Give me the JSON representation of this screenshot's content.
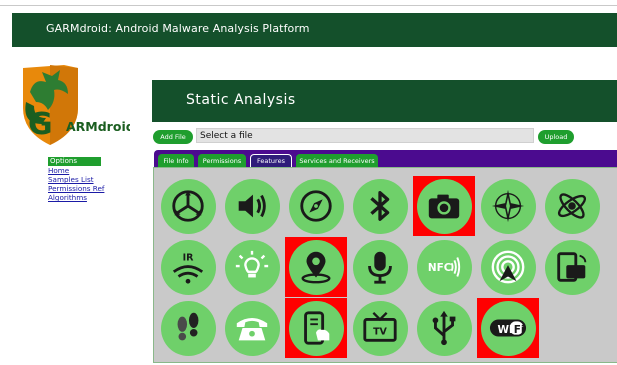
{
  "header": {
    "title": "GARMdroid: Android Malware Analysis Platform"
  },
  "logo": {
    "text": "ARMdroid",
    "letter": "G"
  },
  "sidebar": {
    "options_label": "Options",
    "links": [
      "Home",
      "Samples List",
      "Permissions Ref",
      "Algorithms"
    ]
  },
  "banner": {
    "title": "Static Analysis"
  },
  "upload_form": {
    "add_file_label": "Add File",
    "file_placeholder": "Select a file",
    "upload_label": "Upload"
  },
  "tabs": [
    "File Info",
    "Permissions",
    "Features",
    "Services and Receivers"
  ],
  "active_tab": "Features",
  "features": [
    {
      "icon": "accelerometer-icon",
      "highlighted": false
    },
    {
      "icon": "speaker-icon",
      "highlighted": false
    },
    {
      "icon": "compass-icon",
      "highlighted": false
    },
    {
      "icon": "bluetooth-icon",
      "highlighted": false
    },
    {
      "icon": "camera-icon",
      "highlighted": true
    },
    {
      "icon": "compass-rose-icon",
      "highlighted": false
    },
    {
      "icon": "gyroscope-icon",
      "highlighted": false
    },
    {
      "icon": "infrared-icon",
      "highlighted": false,
      "label": "IR"
    },
    {
      "icon": "light-sensor-icon",
      "highlighted": false
    },
    {
      "icon": "location-icon",
      "highlighted": true
    },
    {
      "icon": "microphone-icon",
      "highlighted": false
    },
    {
      "icon": "nfc-icon",
      "highlighted": false,
      "label": "NFC"
    },
    {
      "icon": "wifi-direct-icon",
      "highlighted": false
    },
    {
      "icon": "screen-rotation-icon",
      "highlighted": false
    },
    {
      "icon": "step-counter-icon",
      "highlighted": false
    },
    {
      "icon": "telephone-icon",
      "highlighted": false
    },
    {
      "icon": "touchscreen-icon",
      "highlighted": true
    },
    {
      "icon": "tv-icon",
      "highlighted": false,
      "label": "TV"
    },
    {
      "icon": "usb-icon",
      "highlighted": false
    },
    {
      "icon": "wifi-icon",
      "highlighted": true,
      "label": "Wi Fi"
    }
  ],
  "colors": {
    "header_green": "#14502b",
    "button_green": "#1f9e2e",
    "tab_purple": "#4b0b8f",
    "icon_green": "#6fd06a",
    "highlight_red": "#ff0000",
    "logo_orange": "#e8890b"
  }
}
